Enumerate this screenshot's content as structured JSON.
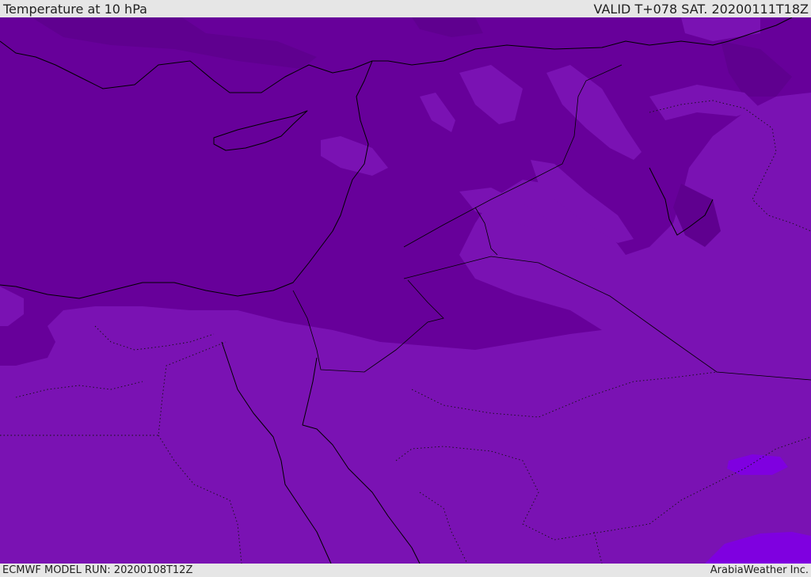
{
  "header": {
    "title": "Temperature at 10 hPa",
    "valid": "VALID T+078 SAT. 20200111T18Z"
  },
  "footer": {
    "model_run": "ECMWF MODEL RUN: 20200108T12Z",
    "credit": "ArabiaWeather Inc."
  },
  "colors": {
    "background": "#e6e6e6",
    "field_dark": "#5f008f",
    "field_mid": "#67009a",
    "field_base": "#7a12b3",
    "field_light": "#8a20c4",
    "field_bright": "#7f00e0"
  }
}
